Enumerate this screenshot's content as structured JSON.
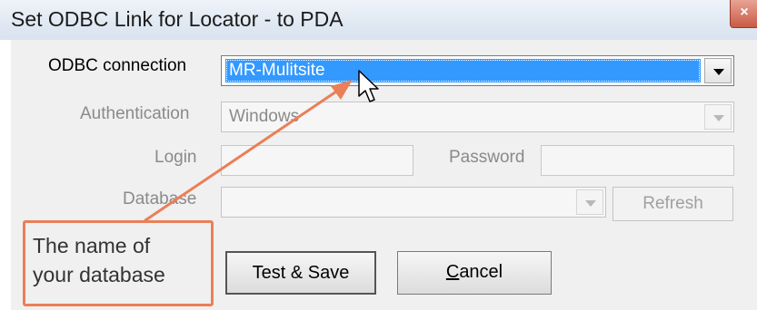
{
  "window": {
    "title": "Set ODBC Link for Locator - to PDA",
    "close_glyph": "×"
  },
  "form": {
    "odbc_label": "ODBC connection",
    "odbc_value": "MR-Mulitsite",
    "auth_label": "Authentication",
    "auth_value": "Windows",
    "login_label": "Login",
    "login_value": "",
    "password_label": "Password",
    "password_value": "",
    "database_label": "Database",
    "database_value": "",
    "refresh_label": "Refresh"
  },
  "buttons": {
    "test_save_label": "Test & Save",
    "cancel_accel": "C",
    "cancel_rest": "ancel"
  },
  "annotation": {
    "line1": "The name of",
    "line2": "your database",
    "color": "#ea7f58"
  },
  "icons": {
    "dropdown": "chevron-down-icon",
    "cursor": "mouse-pointer-icon",
    "close": "close-icon"
  }
}
